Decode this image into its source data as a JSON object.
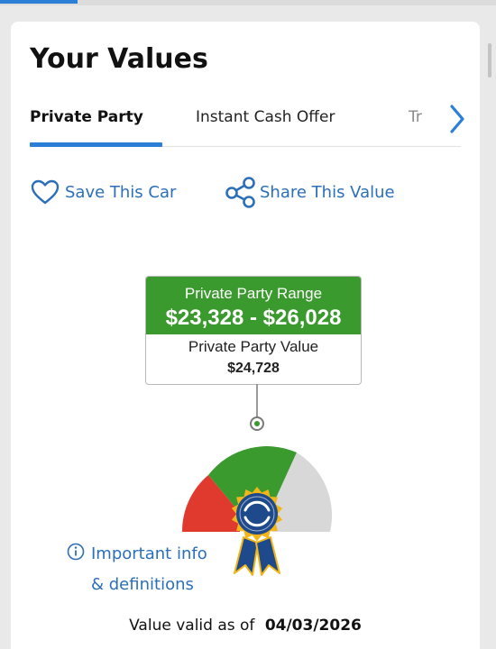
{
  "header": {
    "title": "Your Values"
  },
  "tabs": [
    {
      "label": "Private Party",
      "active": true
    },
    {
      "label": "Instant Cash Offer",
      "active": false
    },
    {
      "label": "Tr",
      "active": false
    }
  ],
  "actions": {
    "save_label": "Save This Car",
    "share_label": "Share This Value"
  },
  "valuation": {
    "range_label": "Private Party Range",
    "range_value": "$23,328 - $26,028",
    "value_label": "Private Party Value",
    "value_amount": "$24,728"
  },
  "gauge": {
    "colors": {
      "low": "#e03a2e",
      "mid": "#3a9a2e",
      "high": "#d8d8d8",
      "badge_blue": "#1e4a8c",
      "badge_gold": "#f2b619"
    }
  },
  "info": {
    "line1": "Important info",
    "line2": "& definitions"
  },
  "footer": {
    "valid_label": "Value valid as of",
    "valid_date": "04/03/2026"
  },
  "colors": {
    "accent": "#2b7fd6",
    "link": "#2b6fb8",
    "green": "#3a9a2e"
  }
}
